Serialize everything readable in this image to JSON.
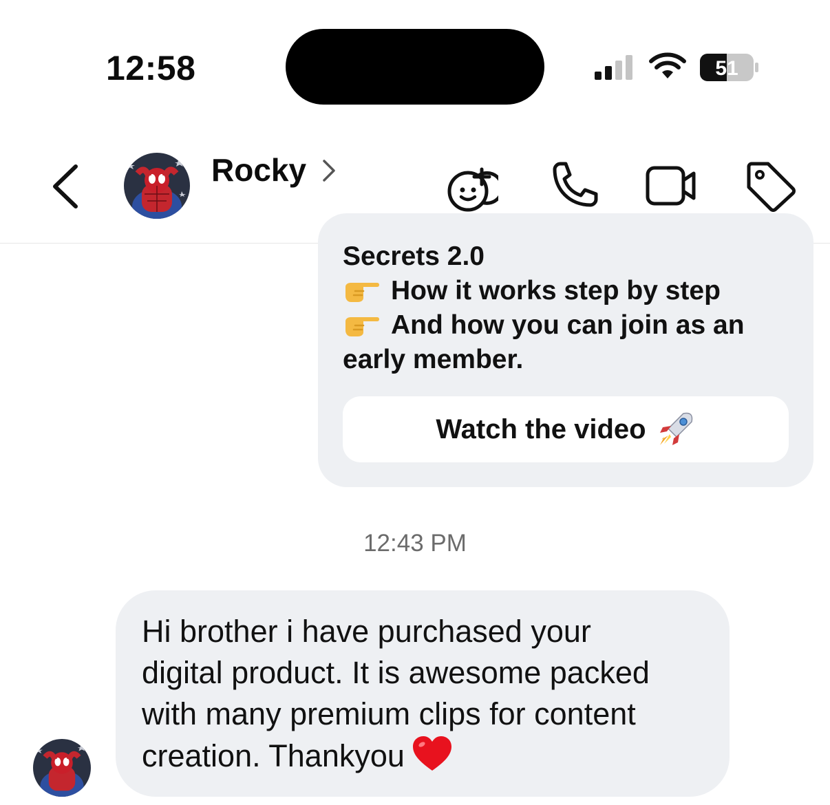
{
  "status_bar": {
    "time": "12:58",
    "battery": "51"
  },
  "header": {
    "contact_name": "Rocky",
    "back_icon": "chevron-left-icon",
    "name_chevron_icon": "chevron-right-icon",
    "actions": [
      {
        "name": "create-sticker",
        "icon": "face-plus-icon"
      },
      {
        "name": "audio-call",
        "icon": "phone-icon"
      },
      {
        "name": "video-call",
        "icon": "video-camera-icon"
      },
      {
        "name": "label",
        "icon": "tag-icon"
      }
    ]
  },
  "chat": {
    "outgoing_message": {
      "lines": [
        "Secrets 2.0",
        "How it works step by step",
        "And how you can join as an",
        "early member."
      ],
      "bullet_icon": "pointing-hand-icon",
      "button_label": "Watch the video",
      "button_icon": "rocket-icon"
    },
    "timestamp": "12:43 PM",
    "incoming_message": {
      "lines": [
        "Hi brother i have purchased your",
        "digital product. It is awesome packed",
        "with many premium clips for content",
        "creation. Thankyou"
      ],
      "emoji_icon": "red-heart-icon"
    }
  },
  "colors": {
    "bubble": "#eef0f3",
    "background": "#ffffff",
    "text": "#111111",
    "timestamp": "#6b6b6b"
  }
}
